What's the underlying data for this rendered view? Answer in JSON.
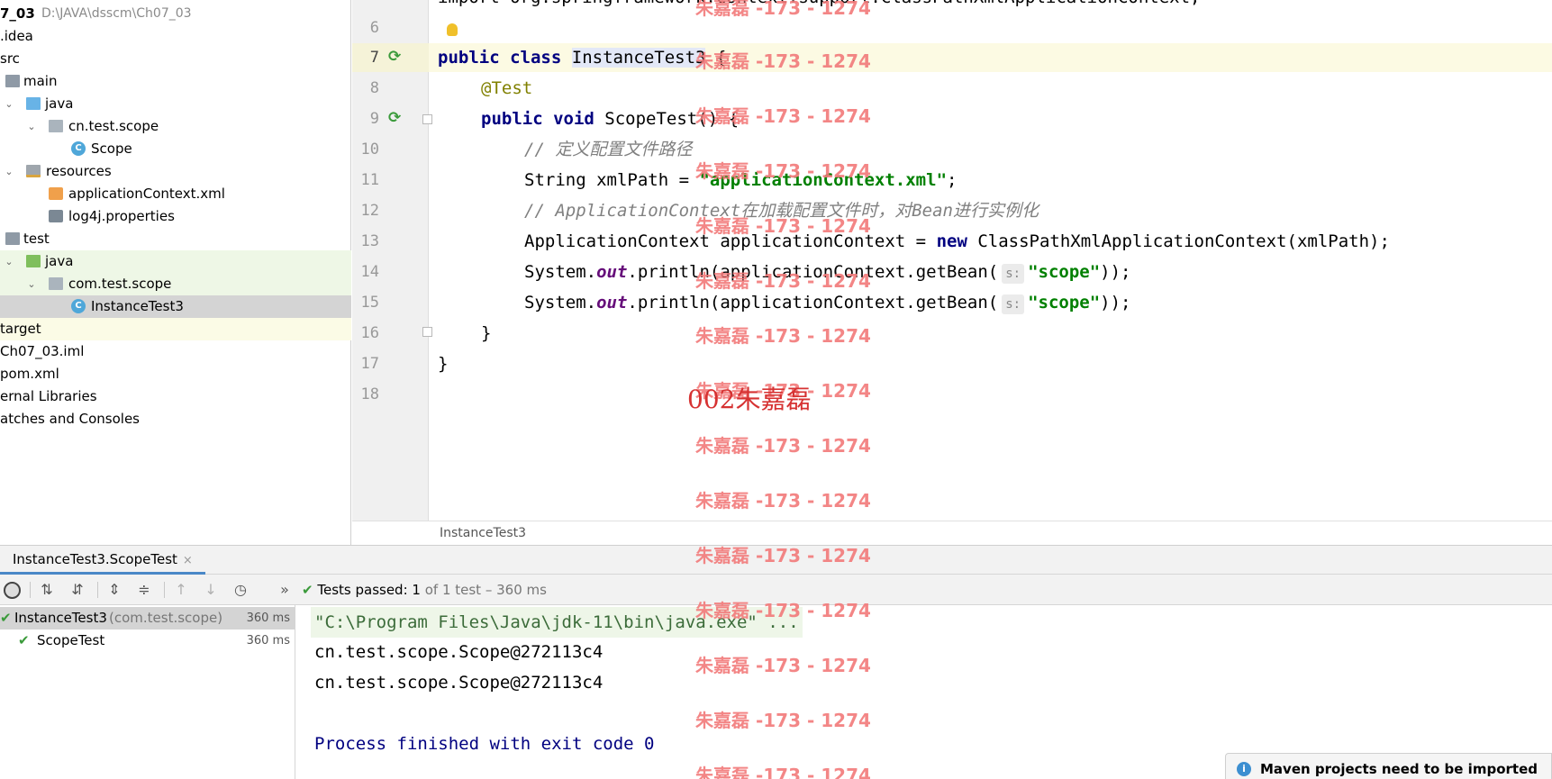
{
  "project": {
    "root_name": "7_03",
    "root_path": "D:\\JAVA\\dsscm\\Ch07_03",
    "items": [
      {
        "label": ".idea"
      },
      {
        "label": "src"
      },
      {
        "label": "main"
      },
      {
        "label": "java"
      },
      {
        "label": "cn.test.scope"
      },
      {
        "label": "Scope"
      },
      {
        "label": "resources"
      },
      {
        "label": "applicationContext.xml"
      },
      {
        "label": "log4j.properties"
      },
      {
        "label": "test"
      },
      {
        "label": "java"
      },
      {
        "label": "com.test.scope"
      },
      {
        "label": "InstanceTest3"
      },
      {
        "label": "target"
      },
      {
        "label": "Ch07_03.iml"
      },
      {
        "label": "pom.xml"
      },
      {
        "label": "ernal Libraries"
      },
      {
        "label": "atches and Consoles"
      }
    ]
  },
  "editor": {
    "line_numbers": [
      "6",
      "7",
      "8",
      "9",
      "10",
      "11",
      "12",
      "13",
      "14",
      "15",
      "16",
      "17",
      "18"
    ],
    "code": {
      "l5_partial": "import org.springframework.context.support.ClassPathXmlApplicationContext;",
      "l7_kw1": "public",
      "l7_kw2": "class",
      "l7_name": "InstanceTest3",
      "l7_brace": " {",
      "l8": "@Test",
      "l9_kw1": "public",
      "l9_kw2": "void",
      "l9_rest": " ScopeTest() {",
      "l10": "// 定义配置文件路径",
      "l11_pre": "String xmlPath = ",
      "l11_str": "\"applicationContext.xml\"",
      "l11_post": ";",
      "l12": "// ApplicationContext在加载配置文件时，对Bean进行实例化",
      "l13_pre": "ApplicationContext applicationContext = ",
      "l13_kw": "new",
      "l13_post": " ClassPathXmlApplicationContext(xmlPath);",
      "l14_pre": "System.",
      "l14_fld": "out",
      "l14_mid": ".println(applicationContext.getBean(",
      "hint": "s:",
      "l14_str": "\"scope\"",
      "l14_post": "));",
      "l16": "}",
      "l17": "}"
    },
    "breadcrumb": "InstanceTest3"
  },
  "run": {
    "tab_label": "InstanceTest3.ScopeTest",
    "tab_close": "×",
    "more": "»",
    "status_prefix": "Tests passed: ",
    "status_count": "1",
    "status_suffix": " of 1 test – 360 ms",
    "tests": [
      {
        "name": "InstanceTest3",
        "pkg": "(com.test.scope)",
        "time": "360 ms"
      },
      {
        "name": "ScopeTest",
        "time": "360 ms"
      }
    ],
    "console": [
      "\"C:\\Program Files\\Java\\jdk-11\\bin\\java.exe\" ...",
      "cn.test.scope.Scope@272113c4",
      "cn.test.scope.Scope@272113c4",
      "",
      "Process finished with exit code 0"
    ]
  },
  "notification": "Maven projects need to be imported",
  "watermark": {
    "text": "朱嘉磊 -173 - 1274",
    "big": "002朱嘉磊"
  },
  "colors": {
    "keyword": "#000080",
    "string": "#008000",
    "annotation": "#808000",
    "comment": "#808080",
    "pass": "#3a9a3a",
    "watermark": "#f27a7a"
  }
}
